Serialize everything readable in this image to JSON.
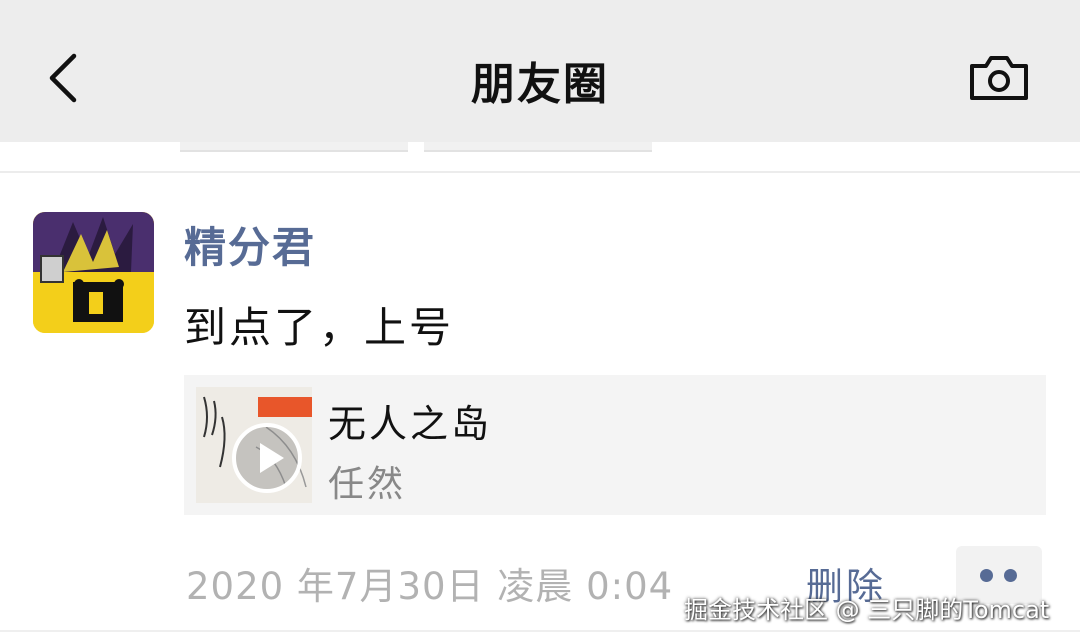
{
  "navbar": {
    "title": "朋友圈",
    "back_icon": "chevron-left-icon",
    "camera_icon": "camera-icon"
  },
  "post": {
    "username": "精分君",
    "text": "到点了，上号",
    "music": {
      "title": "无人之岛",
      "artist": "任然",
      "play_icon": "play-icon"
    },
    "timestamp": "2020 年7月30日 凌晨 0:04",
    "delete_label": "删除",
    "more_icon": "more-dots-icon"
  },
  "watermark": "掘金技术社区 @ 三只脚的Tomcat",
  "colors": {
    "navbar_bg": "#ededed",
    "username": "#576b95",
    "link": "#576b95",
    "timestamp": "#b2b2b2",
    "card_bg": "#f4f4f4"
  }
}
